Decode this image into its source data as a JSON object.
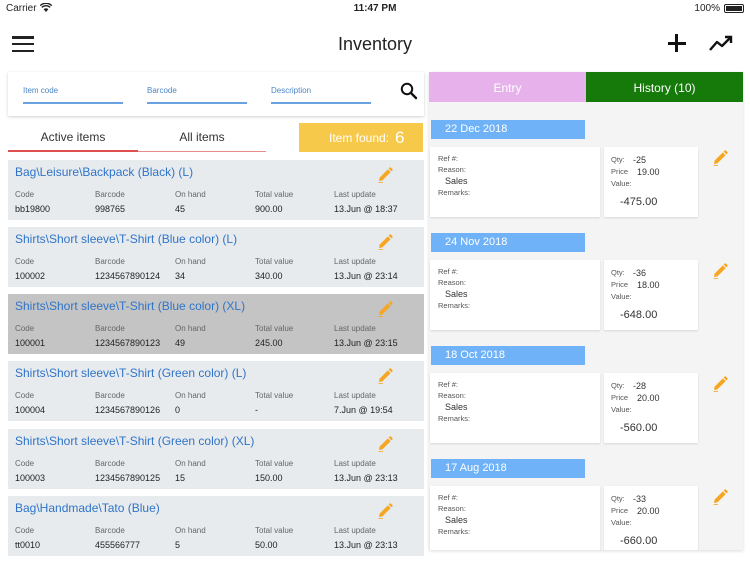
{
  "status_bar": {
    "carrier": "Carrier",
    "time": "11:47 PM",
    "battery": "100%"
  },
  "navbar": {
    "title": "Inventory"
  },
  "search": {
    "item_code_placeholder": "Item code",
    "barcode_placeholder": "Barcode",
    "description_placeholder": "Description"
  },
  "tabs": {
    "active_label": "Active items",
    "all_label": "All items"
  },
  "found": {
    "label": "Item found:",
    "count": "6"
  },
  "columns": {
    "code": "Code",
    "barcode": "Barcode",
    "on_hand": "On hand",
    "total_value": "Total value",
    "last_update": "Last update"
  },
  "items": [
    {
      "name": "Bag\\Leisure\\Backpack (Black) (L)",
      "code": "bb19800",
      "barcode": "998765",
      "on_hand": "45",
      "total_value": "900.00",
      "last_update": "13.Jun @ 18:37"
    },
    {
      "name": "Shirts\\Short sleeve\\T-Shirt (Blue color) (L)",
      "code": "100002",
      "barcode": "1234567890124",
      "on_hand": "34",
      "total_value": "340.00",
      "last_update": "13.Jun @ 23:14"
    },
    {
      "name": "Shirts\\Short sleeve\\T-Shirt (Blue color) (XL)",
      "code": "100001",
      "barcode": "1234567890123",
      "on_hand": "49",
      "total_value": "245.00",
      "last_update": "13.Jun @ 23:15"
    },
    {
      "name": "Shirts\\Short sleeve\\T-Shirt (Green color) (L)",
      "code": "100004",
      "barcode": "1234567890126",
      "on_hand": "0",
      "total_value": "-",
      "last_update": "7.Jun @ 19:54"
    },
    {
      "name": "Shirts\\Short sleeve\\T-Shirt (Green color) (XL)",
      "code": "100003",
      "barcode": "1234567890125",
      "on_hand": "15",
      "total_value": "150.00",
      "last_update": "13.Jun @ 23:13"
    },
    {
      "name": "Bag\\Handmade\\Tato (Blue)",
      "code": "tt0010",
      "barcode": "455566777",
      "on_hand": "5",
      "total_value": "50.00",
      "last_update": "13.Jun @ 23:13"
    }
  ],
  "history_panel": {
    "entry_tab": "Entry",
    "history_tab": "History (10)",
    "labels": {
      "ref": "Ref #:",
      "reason": "Reason:",
      "remarks": "Remarks:",
      "qty": "Qty:",
      "price": "Price",
      "value": "Value:"
    },
    "entries": [
      {
        "date": "22 Dec 2018",
        "reason": "Sales",
        "qty": "-25",
        "price": "19.00",
        "value": "-475.00"
      },
      {
        "date": "24 Nov 2018",
        "reason": "Sales",
        "qty": "-36",
        "price": "18.00",
        "value": "-648.00"
      },
      {
        "date": "18 Oct 2018",
        "reason": "Sales",
        "qty": "-28",
        "price": "20.00",
        "value": "-560.00"
      },
      {
        "date": "17 Aug 2018",
        "reason": "Sales",
        "qty": "-33",
        "price": "20.00",
        "value": "-660.00"
      }
    ]
  },
  "colors": {
    "accent_blue": "#2f74c8",
    "found_yellow": "#f7c94b",
    "entry_pink": "#e7b1ec",
    "history_green": "#157a0a",
    "date_blue": "#6fb2f7",
    "pencil_orange": "#f5a623"
  }
}
